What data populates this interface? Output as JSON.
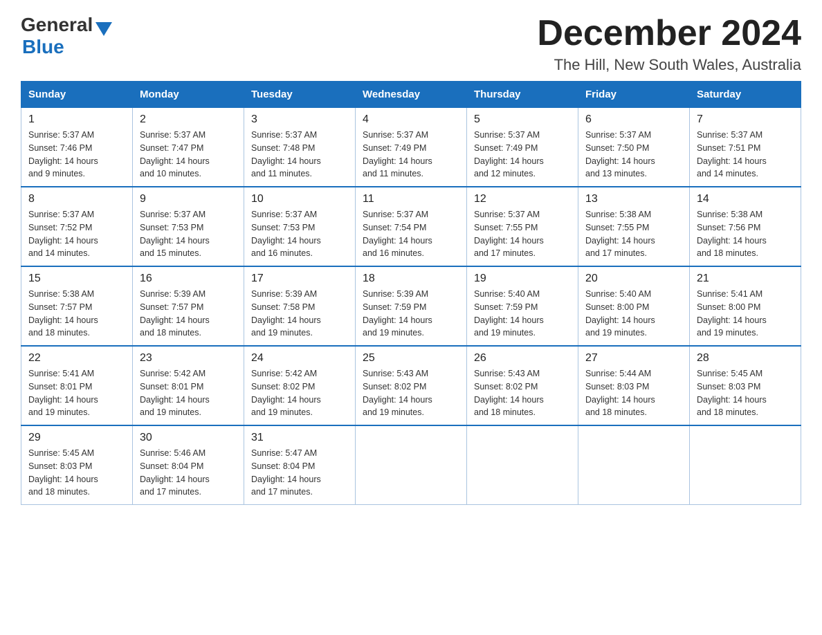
{
  "header": {
    "logo_general": "General",
    "logo_blue": "Blue",
    "month_title": "December 2024",
    "subtitle": "The Hill, New South Wales, Australia"
  },
  "calendar": {
    "days_of_week": [
      "Sunday",
      "Monday",
      "Tuesday",
      "Wednesday",
      "Thursday",
      "Friday",
      "Saturday"
    ],
    "weeks": [
      [
        {
          "day": "1",
          "sunrise": "5:37 AM",
          "sunset": "7:46 PM",
          "daylight": "14 hours and 9 minutes."
        },
        {
          "day": "2",
          "sunrise": "5:37 AM",
          "sunset": "7:47 PM",
          "daylight": "14 hours and 10 minutes."
        },
        {
          "day": "3",
          "sunrise": "5:37 AM",
          "sunset": "7:48 PM",
          "daylight": "14 hours and 11 minutes."
        },
        {
          "day": "4",
          "sunrise": "5:37 AM",
          "sunset": "7:49 PM",
          "daylight": "14 hours and 11 minutes."
        },
        {
          "day": "5",
          "sunrise": "5:37 AM",
          "sunset": "7:49 PM",
          "daylight": "14 hours and 12 minutes."
        },
        {
          "day": "6",
          "sunrise": "5:37 AM",
          "sunset": "7:50 PM",
          "daylight": "14 hours and 13 minutes."
        },
        {
          "day": "7",
          "sunrise": "5:37 AM",
          "sunset": "7:51 PM",
          "daylight": "14 hours and 14 minutes."
        }
      ],
      [
        {
          "day": "8",
          "sunrise": "5:37 AM",
          "sunset": "7:52 PM",
          "daylight": "14 hours and 14 minutes."
        },
        {
          "day": "9",
          "sunrise": "5:37 AM",
          "sunset": "7:53 PM",
          "daylight": "14 hours and 15 minutes."
        },
        {
          "day": "10",
          "sunrise": "5:37 AM",
          "sunset": "7:53 PM",
          "daylight": "14 hours and 16 minutes."
        },
        {
          "day": "11",
          "sunrise": "5:37 AM",
          "sunset": "7:54 PM",
          "daylight": "14 hours and 16 minutes."
        },
        {
          "day": "12",
          "sunrise": "5:37 AM",
          "sunset": "7:55 PM",
          "daylight": "14 hours and 17 minutes."
        },
        {
          "day": "13",
          "sunrise": "5:38 AM",
          "sunset": "7:55 PM",
          "daylight": "14 hours and 17 minutes."
        },
        {
          "day": "14",
          "sunrise": "5:38 AM",
          "sunset": "7:56 PM",
          "daylight": "14 hours and 18 minutes."
        }
      ],
      [
        {
          "day": "15",
          "sunrise": "5:38 AM",
          "sunset": "7:57 PM",
          "daylight": "14 hours and 18 minutes."
        },
        {
          "day": "16",
          "sunrise": "5:39 AM",
          "sunset": "7:57 PM",
          "daylight": "14 hours and 18 minutes."
        },
        {
          "day": "17",
          "sunrise": "5:39 AM",
          "sunset": "7:58 PM",
          "daylight": "14 hours and 19 minutes."
        },
        {
          "day": "18",
          "sunrise": "5:39 AM",
          "sunset": "7:59 PM",
          "daylight": "14 hours and 19 minutes."
        },
        {
          "day": "19",
          "sunrise": "5:40 AM",
          "sunset": "7:59 PM",
          "daylight": "14 hours and 19 minutes."
        },
        {
          "day": "20",
          "sunrise": "5:40 AM",
          "sunset": "8:00 PM",
          "daylight": "14 hours and 19 minutes."
        },
        {
          "day": "21",
          "sunrise": "5:41 AM",
          "sunset": "8:00 PM",
          "daylight": "14 hours and 19 minutes."
        }
      ],
      [
        {
          "day": "22",
          "sunrise": "5:41 AM",
          "sunset": "8:01 PM",
          "daylight": "14 hours and 19 minutes."
        },
        {
          "day": "23",
          "sunrise": "5:42 AM",
          "sunset": "8:01 PM",
          "daylight": "14 hours and 19 minutes."
        },
        {
          "day": "24",
          "sunrise": "5:42 AM",
          "sunset": "8:02 PM",
          "daylight": "14 hours and 19 minutes."
        },
        {
          "day": "25",
          "sunrise": "5:43 AM",
          "sunset": "8:02 PM",
          "daylight": "14 hours and 19 minutes."
        },
        {
          "day": "26",
          "sunrise": "5:43 AM",
          "sunset": "8:02 PM",
          "daylight": "14 hours and 18 minutes."
        },
        {
          "day": "27",
          "sunrise": "5:44 AM",
          "sunset": "8:03 PM",
          "daylight": "14 hours and 18 minutes."
        },
        {
          "day": "28",
          "sunrise": "5:45 AM",
          "sunset": "8:03 PM",
          "daylight": "14 hours and 18 minutes."
        }
      ],
      [
        {
          "day": "29",
          "sunrise": "5:45 AM",
          "sunset": "8:03 PM",
          "daylight": "14 hours and 18 minutes."
        },
        {
          "day": "30",
          "sunrise": "5:46 AM",
          "sunset": "8:04 PM",
          "daylight": "14 hours and 17 minutes."
        },
        {
          "day": "31",
          "sunrise": "5:47 AM",
          "sunset": "8:04 PM",
          "daylight": "14 hours and 17 minutes."
        },
        null,
        null,
        null,
        null
      ]
    ],
    "labels": {
      "sunrise": "Sunrise:",
      "sunset": "Sunset:",
      "daylight": "Daylight:"
    }
  }
}
